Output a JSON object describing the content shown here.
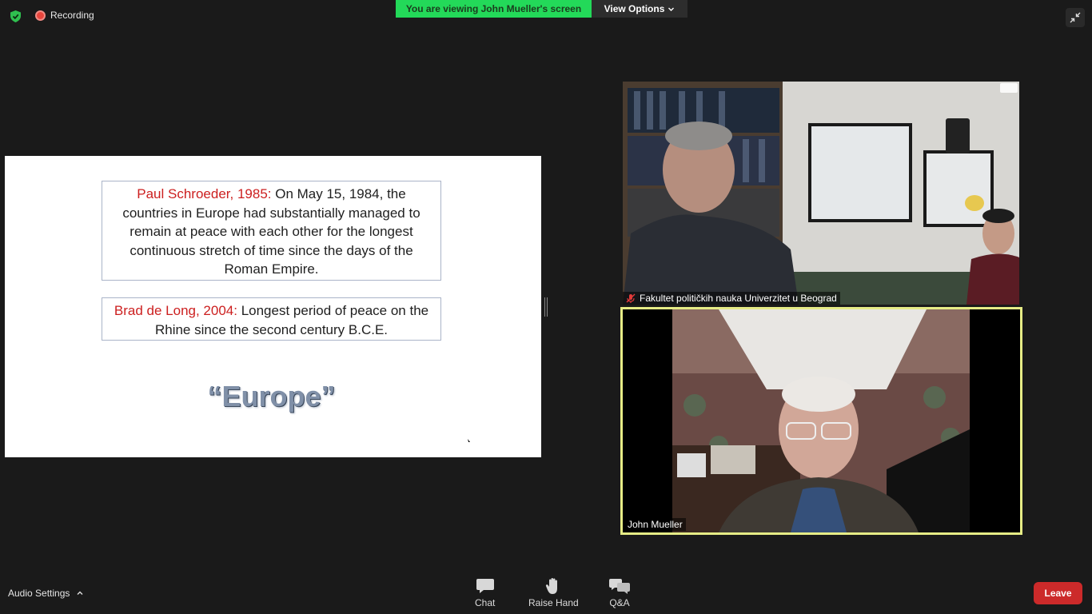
{
  "top": {
    "recording_label": "Recording",
    "viewing_banner": "You are viewing John Mueller's screen",
    "view_options_label": "View Options"
  },
  "slide": {
    "quote1_author": "Paul Schroeder, 1985:",
    "quote1_text": " On May 15, 1984, the countries in Europe had substantially managed to remain at peace with each other for the longest continuous stretch of time since the days of the Roman Empire.",
    "quote2_author": "Brad de Long, 2004:",
    "quote2_text": " Longest period of peace on the Rhine since the second century B.C.E.",
    "heading": "“Europe”"
  },
  "participants": [
    {
      "name": "Fakultet političkih nauka Univerzitet u Beograd",
      "muted": true
    },
    {
      "name": "John Mueller",
      "active_speaker": true
    }
  ],
  "bottom": {
    "audio_settings": "Audio Settings",
    "chat": "Chat",
    "raise_hand": "Raise Hand",
    "qa": "Q&A",
    "leave": "Leave"
  },
  "colors": {
    "banner_green": "#23d959",
    "leave_red": "#cc2a2a",
    "speaker_border": "#e6ec86",
    "quote_author_red": "#cc1f1f"
  }
}
